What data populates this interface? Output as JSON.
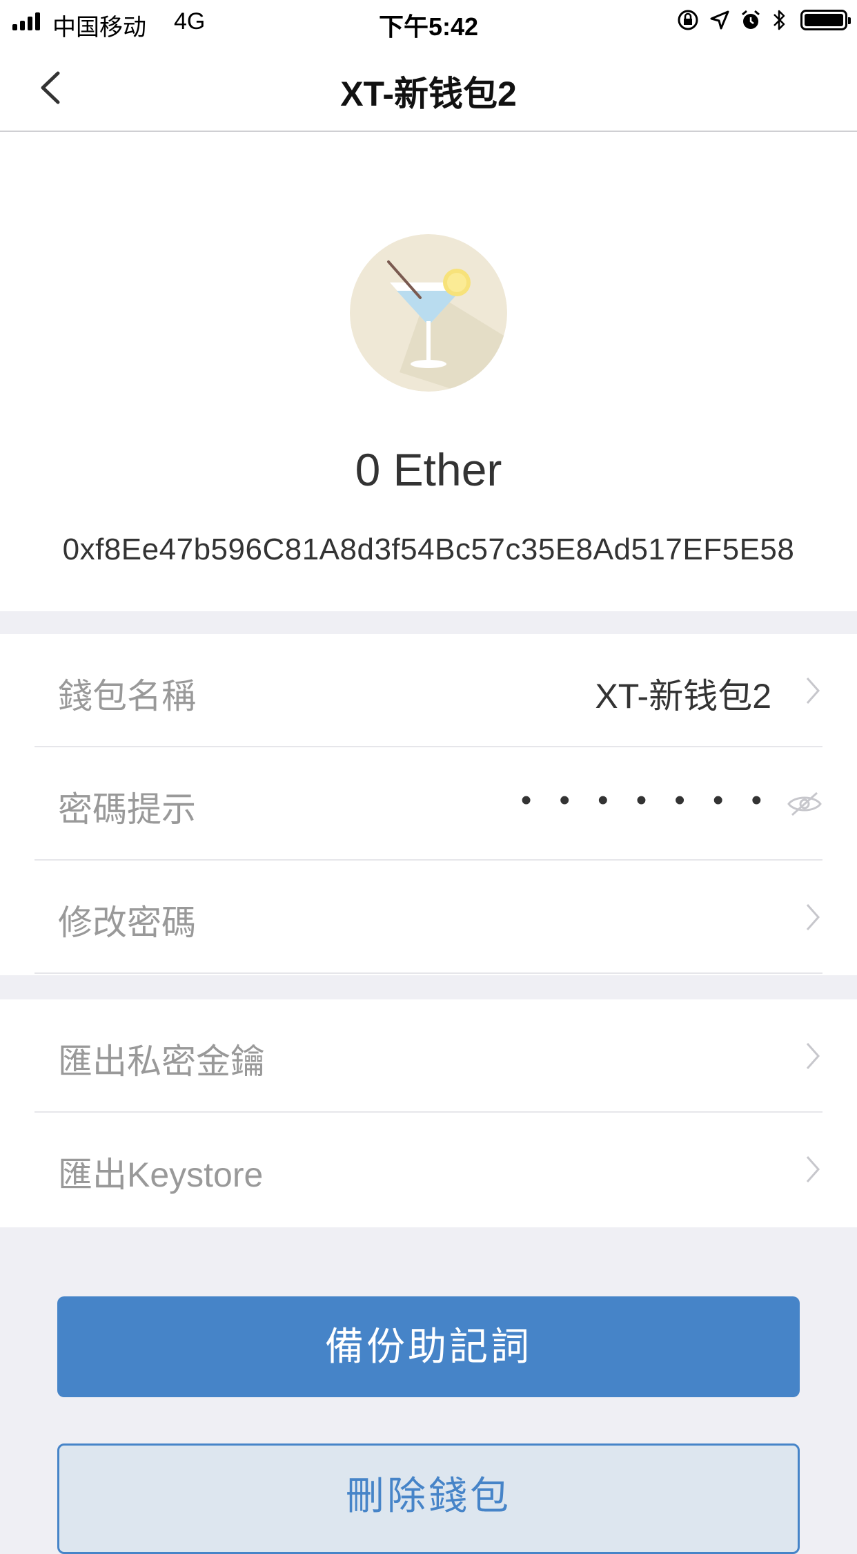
{
  "status_bar": {
    "carrier": "中国移动",
    "network": "4G",
    "time": "下午5:42",
    "icons": [
      "orientation-lock-icon",
      "location-icon",
      "alarm-icon",
      "bluetooth-icon",
      "battery-icon"
    ]
  },
  "nav": {
    "back_icon": "chevron-left-icon",
    "title": "XT-新钱包2"
  },
  "wallet": {
    "avatar_icon": "cocktail-glass-icon",
    "balance": "0 Ether",
    "address": "0xf8Ee47b596C81A8d3f54Bc57c35E8Ad517EF5E58"
  },
  "settings": {
    "name_label": "錢包名稱",
    "name_value": "XT-新钱包2",
    "hint_label": "密碼提示",
    "hint_value": "• • • • • • •",
    "change_password_label": "修改密碼",
    "export_private_key_label": "匯出私密金鑰",
    "export_keystore_label": "匯出Keystore"
  },
  "actions": {
    "backup_mnemonic": "備份助記詞",
    "delete_wallet": "刪除錢包"
  },
  "colors": {
    "accent": "#4684c8",
    "background": "#efeff4"
  }
}
